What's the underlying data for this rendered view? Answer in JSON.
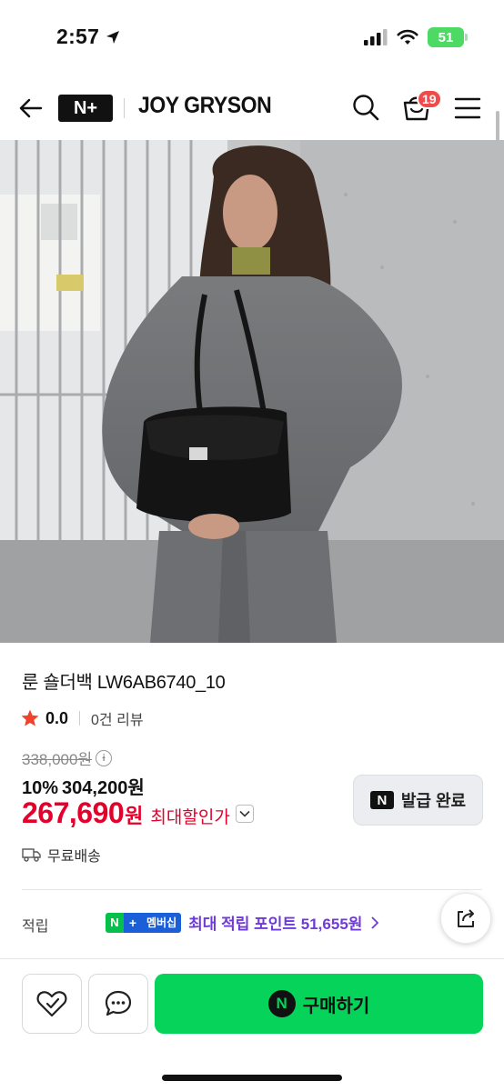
{
  "status_bar": {
    "time": "2:57",
    "battery": "51"
  },
  "header": {
    "logo_text": "N+",
    "brand": "JOY GRYSON",
    "cart_count": "19"
  },
  "product": {
    "title": "룬 숄더백 LW6AB6740_10",
    "rating": "0.0",
    "review_count": "0건 리뷰",
    "original_price": "338,000원",
    "discount_rate": "10%",
    "discounted_price": "304,200원",
    "final_price": "267,690",
    "final_unit": "원",
    "max_discount_label": "최대할인가",
    "coupon_logo": "N",
    "coupon_label": "발급 완료",
    "shipping": "무료배송",
    "points_label": "적립",
    "membership_badge": "멤버십",
    "points_text": "최대 적립 포인트 51,655원"
  },
  "bottom_bar": {
    "buy_logo": "N",
    "buy_label": "구매하기"
  },
  "colors": {
    "price_red": "#e4002b",
    "buy_green": "#06d35a",
    "points_purple": "#6f3bd6",
    "badge_red": "#f04b4b"
  }
}
